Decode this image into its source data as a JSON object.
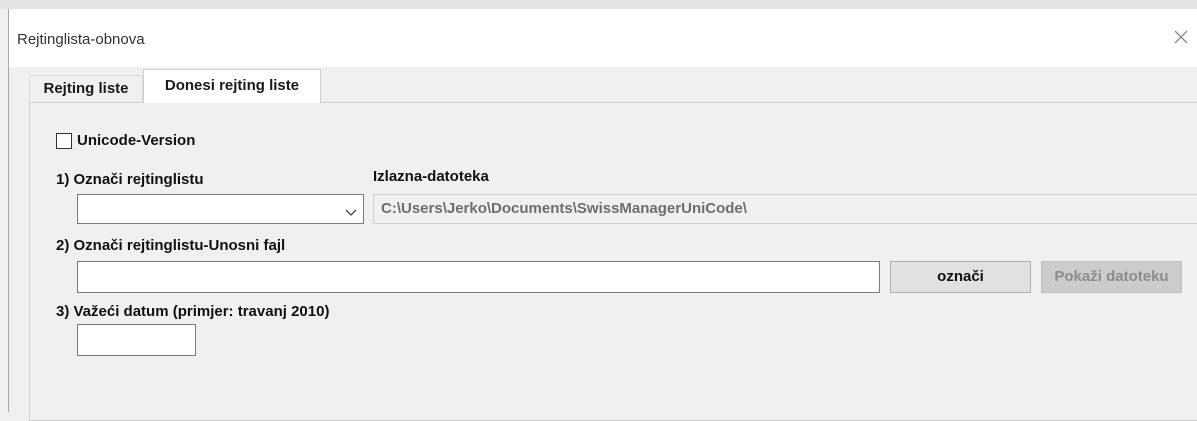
{
  "window": {
    "title": "Rejtinglista-obnova"
  },
  "tabs": [
    {
      "label": "Rejting liste",
      "active": false
    },
    {
      "label": "Donesi rejting liste",
      "active": true
    }
  ],
  "form": {
    "unicode_label": "Unicode-Version",
    "unicode_checked": false,
    "step1_label": "1) Označi rejtinglistu",
    "combo_value": "",
    "output_label": "Izlazna-datoteka",
    "output_value": "C:\\Users\\Jerko\\Documents\\SwissManagerUniCode\\",
    "step2_label": "2) Označi rejtinglistu-Unosni fajl",
    "input_file_value": "",
    "select_button": "označi",
    "show_button": "Pokaži datoteku",
    "step3_label": "3) Važeći datum (primjer: travanj 2010)",
    "date_value": ""
  },
  "icons": {
    "close": "close-icon",
    "dropdown": "chevron-down-icon"
  }
}
